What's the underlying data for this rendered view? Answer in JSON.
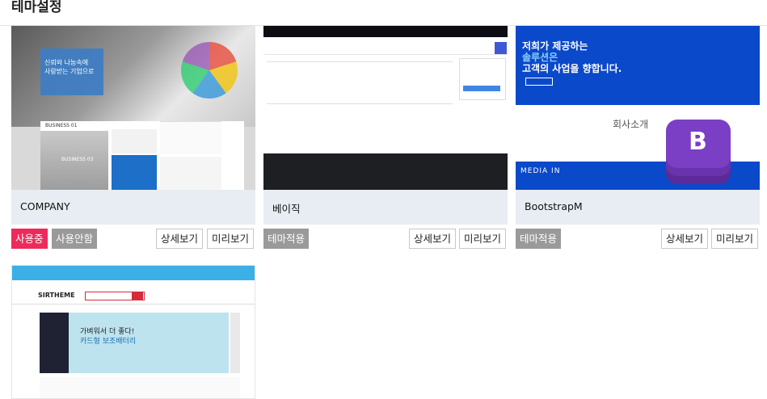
{
  "page": {
    "title": "테마설정"
  },
  "themes": [
    {
      "name": "COMPANY",
      "status_label": "사용중",
      "secondary_label": "사용안함",
      "detail_label": "상세보기",
      "preview_label": "미리보기",
      "thumb": {
        "banner_line1": "신뢰와 나눔속에",
        "banner_line2": "사랑받는 기업으로",
        "section_label": "BUSINESS 01",
        "section_label2": "BUSINESS 03"
      }
    },
    {
      "name": "베이직",
      "status_label": "테마적용",
      "detail_label": "상세보기",
      "preview_label": "미리보기"
    },
    {
      "name": "BootstrapM",
      "status_label": "테마적용",
      "detail_label": "상세보기",
      "preview_label": "미리보기",
      "thumb": {
        "headline1": "저희가 제공하는",
        "headline2": "솔루션은",
        "headline3": "고객의 사업을 향합니다.",
        "section_title": "회사소개",
        "media_label": "MEDIA IN",
        "logo_letter": "B"
      }
    },
    {
      "thumb": {
        "logo_text": "SIRTHEME",
        "promo_line1": "가벼워서 더 좋다!",
        "promo_line2": "카드형 보조배터리"
      }
    }
  ],
  "colors": {
    "active": "#ee2a5c",
    "inactive": "#9a9a9a",
    "namebar": "#e7edf2",
    "accent_blue": "#0a49c9"
  }
}
